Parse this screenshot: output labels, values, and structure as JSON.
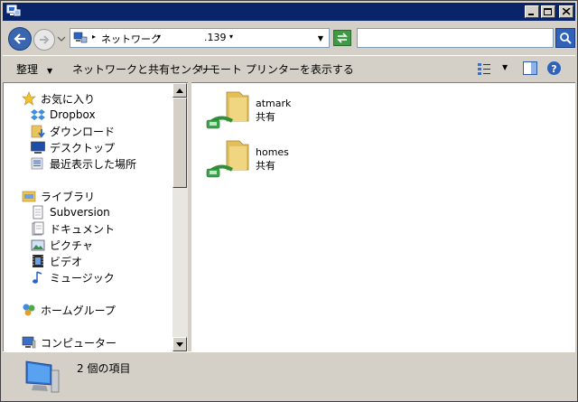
{
  "address": {
    "crumbs": [
      "ネットワーク",
      ".139"
    ],
    "search_placeholder": ""
  },
  "toolbar": {
    "organize": "整理",
    "network_sharing": "ネットワークと共有センター",
    "remote_printers": "リモート プリンターを表示する"
  },
  "navpane": {
    "items": [
      {
        "label": "お気に入り",
        "icon": "star-icon"
      },
      {
        "label": "Dropbox",
        "icon": "dropbox-icon"
      },
      {
        "label": "ダウンロード",
        "icon": "download-folder-icon"
      },
      {
        "label": "デスクトップ",
        "icon": "desktop-icon"
      },
      {
        "label": "最近表示した場所",
        "icon": "recent-places-icon"
      },
      {
        "label": "ライブラリ",
        "icon": "library-icon"
      },
      {
        "label": "Subversion",
        "icon": "document-icon"
      },
      {
        "label": "ドキュメント",
        "icon": "documents-icon"
      },
      {
        "label": "ピクチャ",
        "icon": "pictures-icon"
      },
      {
        "label": "ビデオ",
        "icon": "video-icon"
      },
      {
        "label": "ミュージック",
        "icon": "music-icon"
      },
      {
        "label": "ホームグループ",
        "icon": "homegroup-icon"
      },
      {
        "label": "コンピューター",
        "icon": "computer-icon"
      }
    ]
  },
  "content": {
    "shares": [
      {
        "name": "atmark",
        "subtitle": "共有"
      },
      {
        "name": "homes",
        "subtitle": "共有"
      }
    ]
  },
  "status": {
    "text": "2 個の項目"
  },
  "colors": {
    "titlebar": "#0a246a",
    "window_bg": "#d4d0c8"
  }
}
